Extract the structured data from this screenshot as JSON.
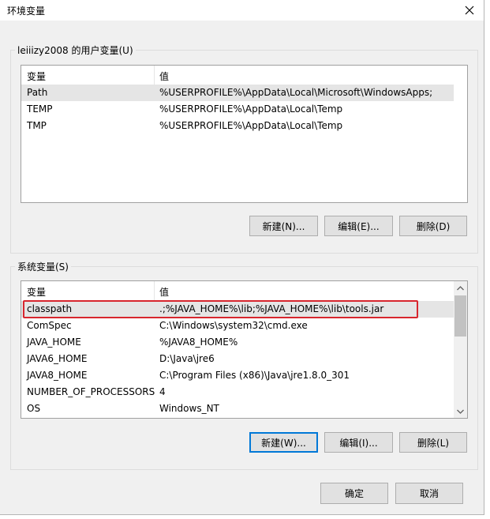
{
  "window": {
    "title": "环境变量"
  },
  "user_vars": {
    "group_label": "leiiizy2008 的用户变量(U)",
    "columns": [
      "变量",
      "值"
    ],
    "rows": [
      {
        "name": "Path",
        "value": "%USERPROFILE%\\AppData\\Local\\Microsoft\\WindowsApps;"
      },
      {
        "name": "TEMP",
        "value": "%USERPROFILE%\\AppData\\Local\\Temp"
      },
      {
        "name": "TMP",
        "value": "%USERPROFILE%\\AppData\\Local\\Temp"
      }
    ],
    "buttons": {
      "new": "新建(N)...",
      "edit": "编辑(E)...",
      "delete": "删除(D)"
    }
  },
  "system_vars": {
    "group_label": "系统变量(S)",
    "columns": [
      "变量",
      "值"
    ],
    "rows": [
      {
        "name": "classpath",
        "value": ".;%JAVA_HOME%\\lib;%JAVA_HOME%\\lib\\tools.jar"
      },
      {
        "name": "ComSpec",
        "value": "C:\\Windows\\system32\\cmd.exe"
      },
      {
        "name": "JAVA_HOME",
        "value": "%JAVA8_HOME%"
      },
      {
        "name": "JAVA6_HOME",
        "value": "D:\\Java\\jre6"
      },
      {
        "name": "JAVA8_HOME",
        "value": "C:\\Program Files (x86)\\Java\\jre1.8.0_301"
      },
      {
        "name": "NUMBER_OF_PROCESSORS",
        "value": "4"
      },
      {
        "name": "OS",
        "value": "Windows_NT"
      }
    ],
    "buttons": {
      "new": "新建(W)...",
      "edit": "编辑(I)...",
      "delete": "删除(L)"
    }
  },
  "footer": {
    "ok": "确定",
    "cancel": "取消"
  },
  "colors": {
    "highlight": "#d8262e",
    "default_button": "#0078d7"
  }
}
